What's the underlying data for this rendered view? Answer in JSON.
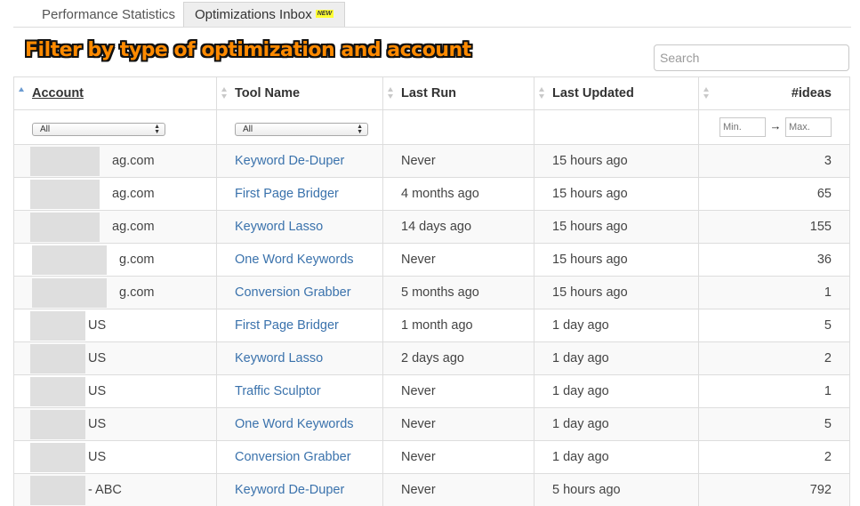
{
  "tabs": [
    {
      "label": "Performance Statistics",
      "active": false
    },
    {
      "label": "Optimizations Inbox",
      "active": true,
      "badge": "NEW"
    }
  ],
  "headline": "Filter by type of optimization and account",
  "search": {
    "placeholder": "Search",
    "value": ""
  },
  "table": {
    "columns": [
      "Account",
      "Tool Name",
      "Last Run",
      "Last Updated",
      "#ideas"
    ],
    "filters": {
      "account": "All",
      "tool_name": "All",
      "ideas_min_placeholder": "Min.",
      "ideas_max_placeholder": "Max.",
      "range_arrow": "→"
    },
    "rows": [
      {
        "account": "ag.com",
        "tool": "Keyword De-Duper",
        "last_run": "Never",
        "last_updated": "15 hours ago",
        "ideas": "3"
      },
      {
        "account": "ag.com",
        "tool": "First Page Bridger",
        "last_run": "4 months ago",
        "last_updated": "15 hours ago",
        "ideas": "65"
      },
      {
        "account": "ag.com",
        "tool": "Keyword Lasso",
        "last_run": "14 days ago",
        "last_updated": "15 hours ago",
        "ideas": "155"
      },
      {
        "account": "g.com",
        "tool": "One Word Keywords",
        "last_run": "Never",
        "last_updated": "15 hours ago",
        "ideas": "36"
      },
      {
        "account": "g.com",
        "tool": "Conversion Grabber",
        "last_run": "5 months ago",
        "last_updated": "15 hours ago",
        "ideas": "1"
      },
      {
        "account": "US",
        "tool": "First Page Bridger",
        "last_run": "1 month ago",
        "last_updated": "1 day ago",
        "ideas": "5"
      },
      {
        "account": "US",
        "tool": "Keyword Lasso",
        "last_run": "2 days ago",
        "last_updated": "1 day ago",
        "ideas": "2"
      },
      {
        "account": "US",
        "tool": "Traffic Sculptor",
        "last_run": "Never",
        "last_updated": "1 day ago",
        "ideas": "1"
      },
      {
        "account": "US",
        "tool": "One Word Keywords",
        "last_run": "Never",
        "last_updated": "1 day ago",
        "ideas": "5"
      },
      {
        "account": "US",
        "tool": "Conversion Grabber",
        "last_run": "Never",
        "last_updated": "1 day ago",
        "ideas": "2"
      },
      {
        "account": "- ABC",
        "tool": "Keyword De-Duper",
        "last_run": "Never",
        "last_updated": "5 hours ago",
        "ideas": "792"
      }
    ]
  },
  "colors": {
    "headline_fill": "#ff8a00",
    "link": "#3a72ac",
    "badge_bg": "#ffff33",
    "sort_active": "#6b9bd1"
  }
}
